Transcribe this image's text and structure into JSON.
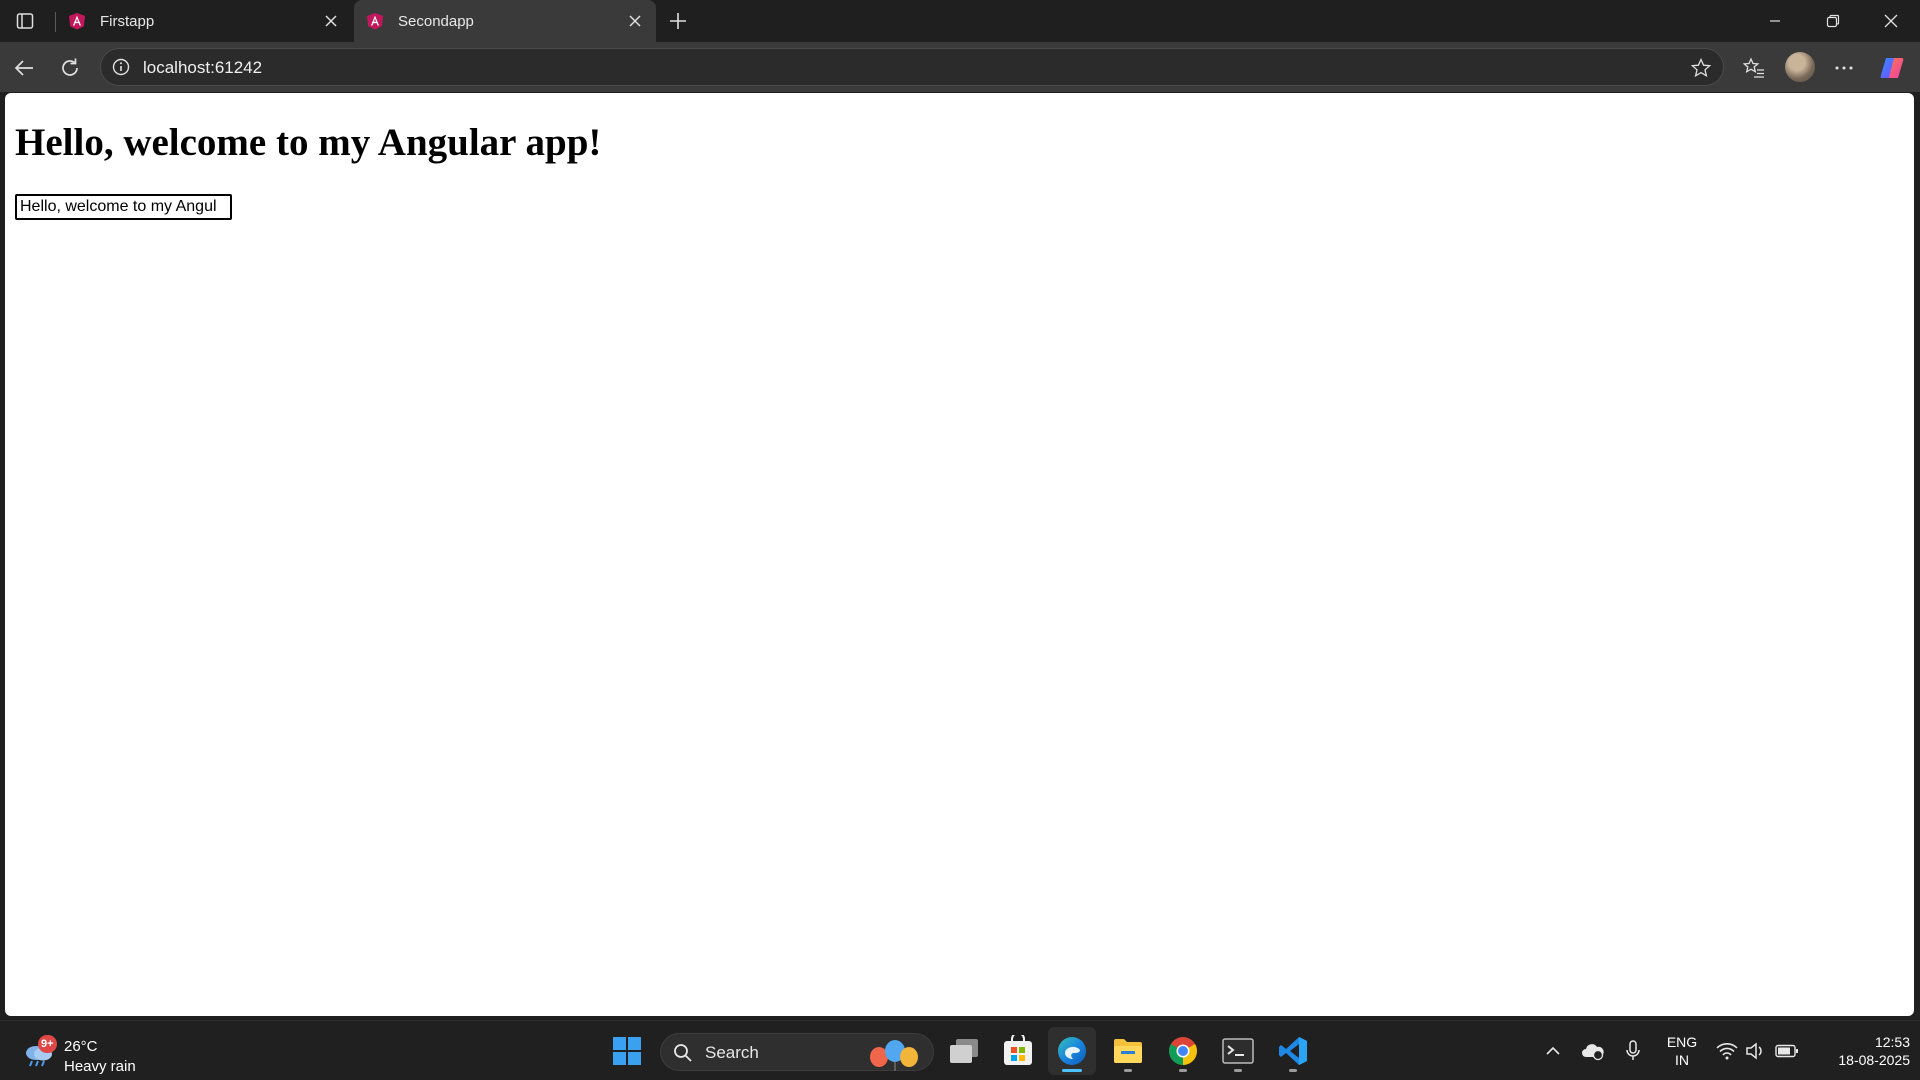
{
  "browser": {
    "tabs": [
      {
        "title": "Firstapp",
        "active": false
      },
      {
        "title": "Secondapp",
        "active": true
      }
    ],
    "url": "localhost:61242"
  },
  "page": {
    "heading": "Hello, welcome to my Angular app!",
    "input_value": "Hello, welcome to my Angul"
  },
  "taskbar": {
    "weather": {
      "badge": "9+",
      "temp": "26°C",
      "condition": "Heavy rain"
    },
    "search_label": "Search",
    "apps": [
      "task-view",
      "microsoft-store",
      "edge",
      "file-explorer",
      "chrome",
      "terminal",
      "vscode"
    ],
    "active_app": "edge",
    "tray": {
      "lang_line1": "ENG",
      "lang_line2": "IN"
    },
    "clock": {
      "time": "12:53",
      "date": "18-08-2025"
    }
  },
  "colors": {
    "chrome_bg": "#1f1f1f",
    "toolbar_bg": "#3a3a3a",
    "accent": "#4cc2ff",
    "angular_favicon": "#dd0031"
  }
}
